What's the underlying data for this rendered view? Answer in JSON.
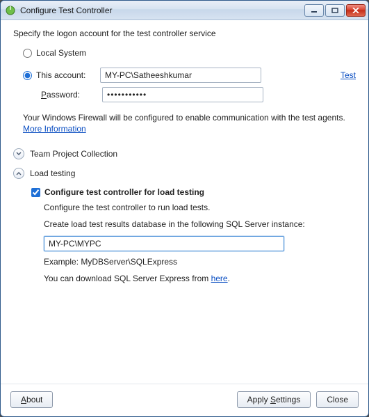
{
  "window": {
    "title": "Configure Test Controller"
  },
  "logon": {
    "heading": "Specify the logon account for the test controller service",
    "local_label": "Local System",
    "this_account_label": "This account:",
    "account_value": "MY-PC\\Satheeshkumar",
    "test_link": "Test",
    "password_label_pre": "P",
    "password_label_post": "assword:",
    "password_value": "●●●●●●●●●●●",
    "firewall_note": "Your Windows Firewall will be configured to enable communication with the test agents. ",
    "more_info": "More Information"
  },
  "expanders": {
    "tpc_label": "Team Project Collection",
    "load_label": "Load testing"
  },
  "load": {
    "chk_label": "Configure test controller for load testing",
    "desc": "Configure the test controller to run load tests.",
    "sql_prompt": "Create load test results database in the following SQL Server instance:",
    "sql_value": "MY-PC\\MYPC",
    "example": "Example: MyDBServer\\SQLExpress",
    "download_pre": "You can download SQL Server Express from ",
    "download_link": "here",
    "download_post": "."
  },
  "footer": {
    "about_pre": "A",
    "about_post": "bout",
    "apply_pre": "Apply ",
    "apply_post": "S",
    "apply_tail": "ettings",
    "close": "Close"
  }
}
